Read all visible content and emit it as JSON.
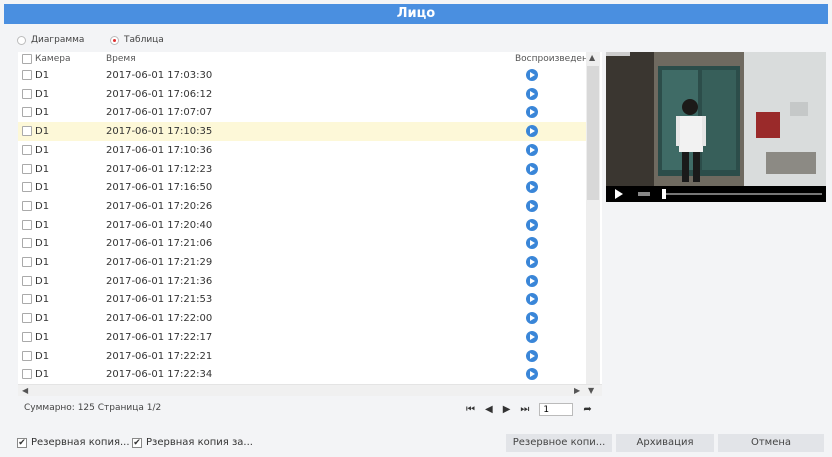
{
  "window": {
    "title": "Лицо"
  },
  "view_mode": {
    "options": [
      "Диаграмма",
      "Таблица"
    ],
    "selected": "Таблица"
  },
  "table": {
    "columns": {
      "camera": "Камера",
      "time": "Время",
      "playback": "Воспроизведен"
    },
    "rows": [
      {
        "camera": "D1",
        "time": "2017-06-01 17:03:30"
      },
      {
        "camera": "D1",
        "time": "2017-06-01 17:06:12"
      },
      {
        "camera": "D1",
        "time": "2017-06-01 17:07:07"
      },
      {
        "camera": "D1",
        "time": "2017-06-01 17:10:35"
      },
      {
        "camera": "D1",
        "time": "2017-06-01 17:10:36"
      },
      {
        "camera": "D1",
        "time": "2017-06-01 17:12:23"
      },
      {
        "camera": "D1",
        "time": "2017-06-01 17:16:50"
      },
      {
        "camera": "D1",
        "time": "2017-06-01 17:20:26"
      },
      {
        "camera": "D1",
        "time": "2017-06-01 17:20:40"
      },
      {
        "camera": "D1",
        "time": "2017-06-01 17:21:06"
      },
      {
        "camera": "D1",
        "time": "2017-06-01 17:21:29"
      },
      {
        "camera": "D1",
        "time": "2017-06-01 17:21:36"
      },
      {
        "camera": "D1",
        "time": "2017-06-01 17:21:53"
      },
      {
        "camera": "D1",
        "time": "2017-06-01 17:22:00"
      },
      {
        "camera": "D1",
        "time": "2017-06-01 17:22:17"
      },
      {
        "camera": "D1",
        "time": "2017-06-01 17:22:21"
      },
      {
        "camera": "D1",
        "time": "2017-06-01 17:22:34"
      }
    ],
    "selected_row_index": 3
  },
  "summary": "Суммарно: 125 Страница 1/2",
  "pager": {
    "page_value": "1"
  },
  "bottom": {
    "checkbox1_label": "Резервная копия...",
    "checkbox2_label": "Рзервная копия за...",
    "backup_button": "Резервное копи...",
    "archive_button": "Архивация",
    "cancel_button": "Отмена"
  },
  "colors": {
    "title_bar": "#4a8fe0",
    "play_button": "#3a86d8",
    "selected_row": "#fdf8d8",
    "radio_selected": "#e03030"
  }
}
